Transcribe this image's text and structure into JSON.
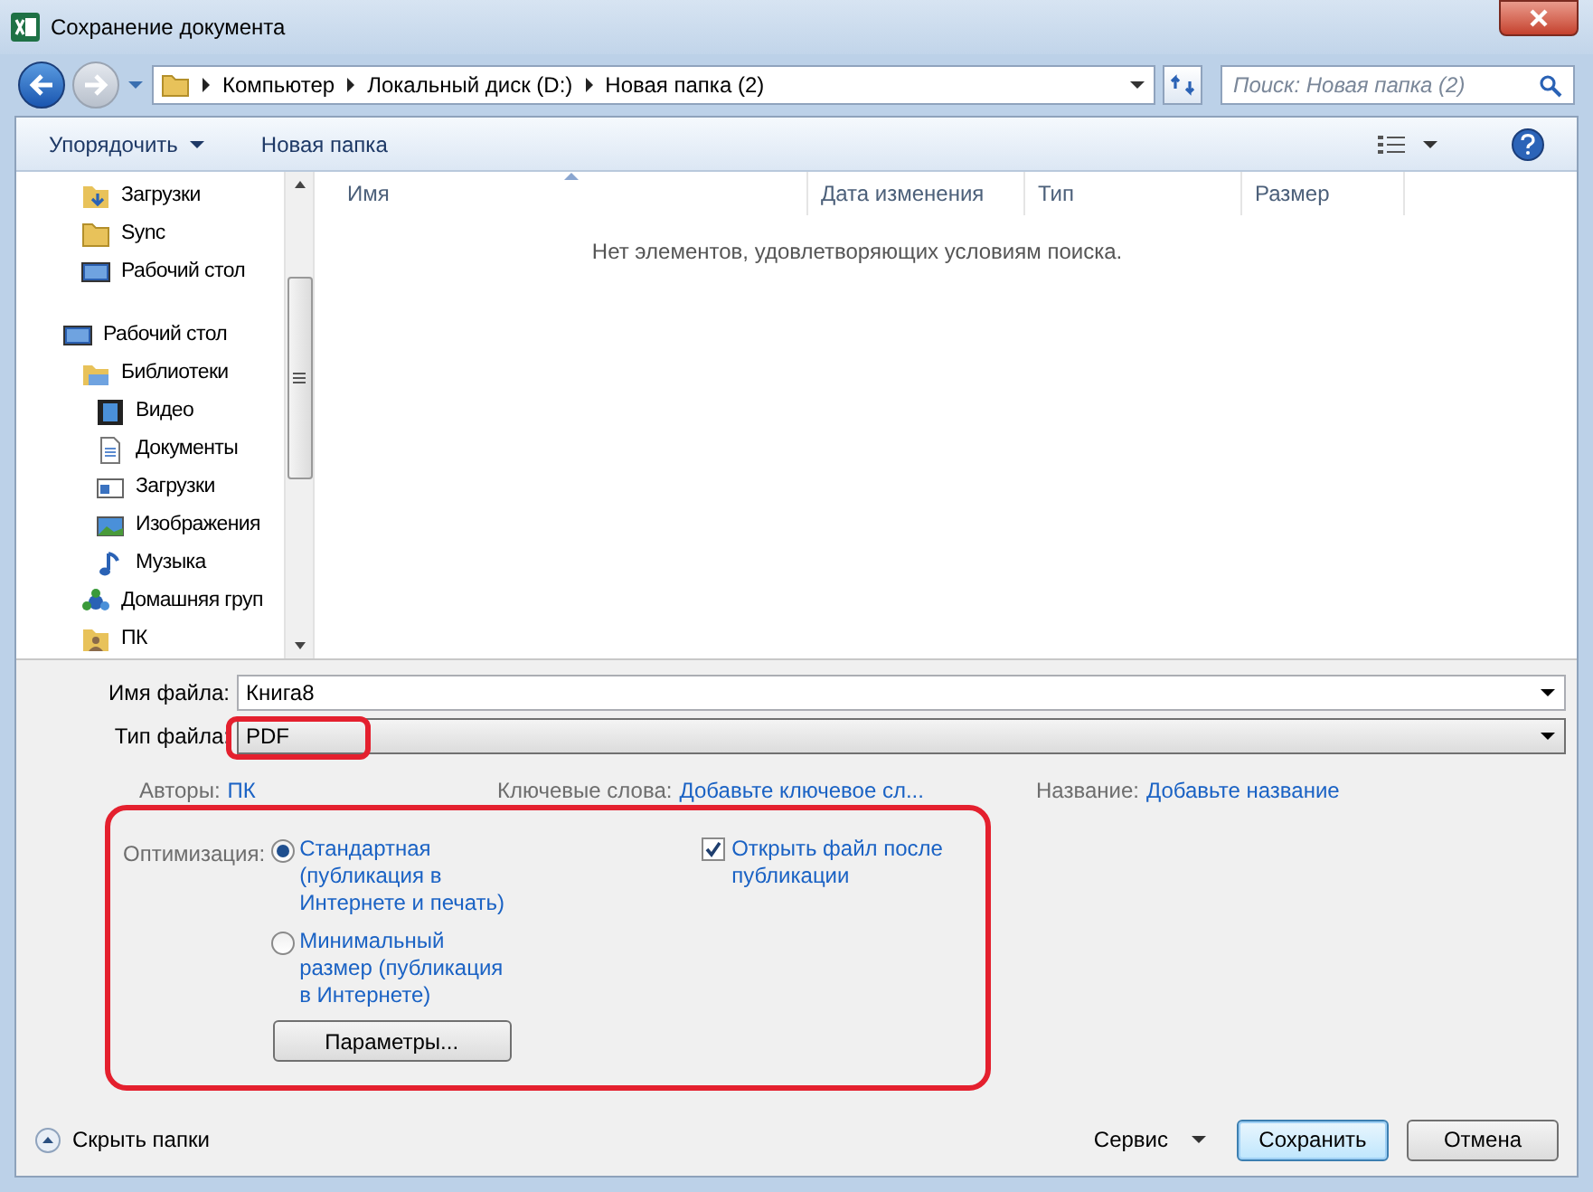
{
  "window": {
    "title": "Сохранение документа"
  },
  "address": {
    "path": [
      "Компьютер",
      "Локальный диск (D:)",
      "Новая папка (2)"
    ],
    "search_placeholder": "Поиск: Новая папка (2)"
  },
  "toolbar": {
    "organize": "Упорядочить",
    "new_folder": "Новая папка"
  },
  "nav": [
    {
      "label": "Загрузки",
      "kind": "downloads"
    },
    {
      "label": "Sync",
      "kind": "folder"
    },
    {
      "label": "Рабочий стол",
      "kind": "desktop"
    },
    {
      "label": "Рабочий стол",
      "kind": "desktop",
      "children": [
        {
          "label": "Библиотеки",
          "kind": "library",
          "children": [
            {
              "label": "Видео",
              "kind": "video"
            },
            {
              "label": "Документы",
              "kind": "document"
            },
            {
              "label": "Загрузки",
              "kind": "window"
            },
            {
              "label": "Изображения",
              "kind": "image"
            },
            {
              "label": "Музыка",
              "kind": "music"
            }
          ]
        },
        {
          "label": "Домашняя груп",
          "kind": "network"
        },
        {
          "label": "ПК",
          "kind": "user"
        }
      ]
    }
  ],
  "columns": [
    "Имя",
    "Дата изменения",
    "Тип",
    "Размер"
  ],
  "empty_message": "Нет элементов, удовлетворяющих условиям поиска.",
  "file_name": {
    "label": "Имя файла:",
    "value": "Книга8"
  },
  "file_type": {
    "label": "Тип файла:",
    "value": "PDF"
  },
  "meta": [
    {
      "label": "Авторы:",
      "value": "ПК"
    },
    {
      "label": "Ключевые слова:",
      "value": "Добавьте ключевое сл..."
    },
    {
      "label": "Название:",
      "value": "Добавьте название"
    }
  ],
  "optimization": {
    "label": "Оптимизация:",
    "options": [
      {
        "label": "Стандартная (публикация в Интернете и печать)",
        "selected": true
      },
      {
        "label": "Минимальный размер (публикация в Интернете)",
        "selected": false
      }
    ]
  },
  "open_after": {
    "label": "Открыть файл после публикации",
    "checked": true
  },
  "options_button": "Параметры...",
  "hide_folders": "Скрыть папки",
  "tools": "Сервис",
  "buttons": [
    {
      "label": "Сохранить",
      "kind": "primary"
    },
    {
      "label": "Отмена",
      "kind": "normal"
    }
  ]
}
